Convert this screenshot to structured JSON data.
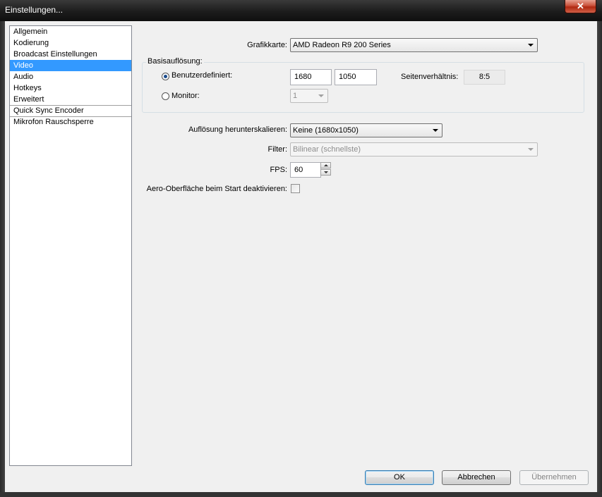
{
  "window": {
    "title": "Einstellungen...",
    "close_glyph": "✕"
  },
  "sidebar": {
    "items": [
      {
        "label": "Allgemein"
      },
      {
        "label": "Kodierung"
      },
      {
        "label": "Broadcast Einstellungen"
      },
      {
        "label": "Video",
        "selected": true
      },
      {
        "label": "Audio"
      },
      {
        "label": "Hotkeys"
      },
      {
        "label": "Erweitert"
      },
      {
        "label": "Quick Sync Encoder"
      },
      {
        "label": "Mikrofon Rauschsperre"
      }
    ]
  },
  "video": {
    "graphics_label": "Grafikkarte:",
    "graphics_value": "AMD Radeon R9 200 Series",
    "base_resolution": {
      "group_title": "Basisauflösung:",
      "custom_label": "Benutzerdefiniert:",
      "custom_selected": true,
      "width": "1680",
      "height": "1050",
      "aspect_label": "Seitenverhältnis:",
      "aspect_value": "8:5",
      "monitor_label": "Monitor:",
      "monitor_value": "1"
    },
    "downscale_label": "Auflösung herunterskalieren:",
    "downscale_value": "Keine  (1680x1050)",
    "filter_label": "Filter:",
    "filter_value": "Bilinear (schnellste)",
    "fps_label": "FPS:",
    "fps_value": "60",
    "aero_label": "Aero-Oberfläche beim Start deaktivieren:",
    "aero_checked": false
  },
  "buttons": {
    "ok": "OK",
    "cancel": "Abbrechen",
    "apply": "Übernehmen"
  }
}
